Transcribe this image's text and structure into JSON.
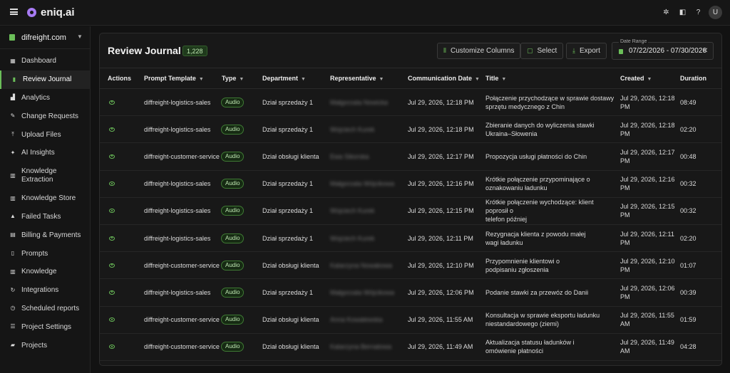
{
  "app": {
    "name": "eniq.ai",
    "avatar_initial": "U"
  },
  "topbar_icons": [
    "settings-wheel-icon",
    "panel-icon",
    "help-icon"
  ],
  "workspace": {
    "name": "difreight.com"
  },
  "sidebar": {
    "items": [
      {
        "label": "Dashboard",
        "icon": "dashboard-icon"
      },
      {
        "label": "Review Journal",
        "icon": "journal-icon",
        "active": true
      },
      {
        "label": "Analytics",
        "icon": "analytics-icon"
      },
      {
        "label": "Change Requests",
        "icon": "pencil-icon"
      },
      {
        "label": "Upload Files",
        "icon": "upload-icon"
      },
      {
        "label": "AI Insights",
        "icon": "sparkle-icon"
      },
      {
        "label": "Knowledge Extraction",
        "icon": "book-icon"
      },
      {
        "label": "Knowledge Store",
        "icon": "book-icon"
      },
      {
        "label": "Failed Tasks",
        "icon": "warning-icon"
      },
      {
        "label": "Billing & Payments",
        "icon": "bank-icon"
      },
      {
        "label": "Prompts",
        "icon": "document-icon"
      },
      {
        "label": "Knowledge",
        "icon": "book-icon"
      },
      {
        "label": "Integrations",
        "icon": "sync-icon"
      },
      {
        "label": "Scheduled reports",
        "icon": "clock-icon"
      },
      {
        "label": "Project Settings",
        "icon": "sliders-icon"
      },
      {
        "label": "Projects",
        "icon": "folder-icon"
      }
    ]
  },
  "page": {
    "title": "Review Journal",
    "count": "1,228",
    "customize_label": "Customize Columns",
    "select_label": "Select",
    "export_label": "Export",
    "date_range_label": "Date Range",
    "date_range_value": "07/22/2026 - 07/30/2026"
  },
  "table": {
    "columns": [
      "Actions",
      "Prompt Template",
      "Type",
      "Department",
      "Representative",
      "Communication Date",
      "Title",
      "Created",
      "Duration"
    ],
    "rows": [
      {
        "template": "diffreight-logistics-sales",
        "type": "Audio",
        "department": "Dział sprzedaży 1",
        "rep": "Małgorzata Nowicka",
        "comm_date": "Jul 29, 2026, 12:18 PM",
        "title": [
          "Połączenie przychodzące w sprawie dostawy",
          "sprzętu medycznego z Chin"
        ],
        "created": [
          "Jul 29, 2026, 12:18",
          "PM"
        ],
        "duration": "08:49"
      },
      {
        "template": "diffreight-logistics-sales",
        "type": "Audio",
        "department": "Dział sprzedaży 1",
        "rep": "Wojciech Kurek",
        "comm_date": "Jul 29, 2026, 12:18 PM",
        "title": [
          "Zbieranie danych do wyliczenia stawki",
          "Ukraina–Słowenia"
        ],
        "created": [
          "Jul 29, 2026, 12:18",
          "PM"
        ],
        "duration": "02:20"
      },
      {
        "template": "diffreight-customer-service",
        "type": "Audio",
        "department": "Dział obsługi klienta",
        "rep": "Ewa Sikorska",
        "comm_date": "Jul 29, 2026, 12:17 PM",
        "title": [
          "Propozycja usługi płatności do Chin"
        ],
        "created": [
          "Jul 29, 2026, 12:17",
          "PM"
        ],
        "duration": "00:48"
      },
      {
        "template": "diffreight-logistics-sales",
        "type": "Audio",
        "department": "Dział sprzedaży 1",
        "rep": "Małgorzata Wójcikowa",
        "comm_date": "Jul 29, 2026, 12:16 PM",
        "title": [
          "Krótkie połączenie przypominające o",
          "oznakowaniu ładunku"
        ],
        "created": [
          "Jul 29, 2026, 12:16",
          "PM"
        ],
        "duration": "00:32"
      },
      {
        "template": "diffreight-logistics-sales",
        "type": "Audio",
        "department": "Dział sprzedaży 1",
        "rep": "Wojciech Kurek",
        "comm_date": "Jul 29, 2026, 12:15 PM",
        "title": [
          "Krótkie połączenie wychodzące: klient poprosił o",
          "telefon później"
        ],
        "created": [
          "Jul 29, 2026, 12:15",
          "PM"
        ],
        "duration": "00:32"
      },
      {
        "template": "diffreight-logistics-sales",
        "type": "Audio",
        "department": "Dział sprzedaży 1",
        "rep": "Wojciech Kurek",
        "comm_date": "Jul 29, 2026, 12:11 PM",
        "title": [
          "Rezygnacja klienta z powodu małej",
          "wagi ładunku"
        ],
        "created": [
          "Jul 29, 2026, 12:11",
          "PM"
        ],
        "duration": "02:20"
      },
      {
        "template": "diffreight-customer-service",
        "type": "Audio",
        "department": "Dział obsługi klienta",
        "rep": "Katarzyna Nowakowa",
        "comm_date": "Jul 29, 2026, 12:10 PM",
        "title": [
          "Przypomnienie klientowi o",
          "podpisaniu zgłoszenia"
        ],
        "created": [
          "Jul 29, 2026, 12:10",
          "PM"
        ],
        "duration": "01:07"
      },
      {
        "template": "diffreight-logistics-sales",
        "type": "Audio",
        "department": "Dział sprzedaży 1",
        "rep": "Małgorzata Wójcikowa",
        "comm_date": "Jul 29, 2026, 12:06 PM",
        "title": [
          "Podanie stawki za przewóz do Danii"
        ],
        "created": [
          "Jul 29, 2026, 12:06",
          "PM"
        ],
        "duration": "00:39"
      },
      {
        "template": "diffreight-customer-service",
        "type": "Audio",
        "department": "Dział obsługi klienta",
        "rep": "Anna Kowalewska",
        "comm_date": "Jul 29, 2026, 11:55 AM",
        "title": [
          "Konsultacja w sprawie eksportu ładunku",
          "niestandardowego (ziemi)"
        ],
        "created": [
          "Jul 29, 2026, 11:55",
          "AM"
        ],
        "duration": "01:59"
      },
      {
        "template": "diffreight-customer-service",
        "type": "Audio",
        "department": "Dział obsługi klienta",
        "rep": "Katarzyna Bernatowa",
        "comm_date": "Jul 29, 2026, 11:49 AM",
        "title": [
          "Aktualizacja statusu ładunków i",
          "omówienie płatności"
        ],
        "created": [
          "Jul 29, 2026, 11:49",
          "AM"
        ],
        "duration": "04:28"
      }
    ]
  }
}
